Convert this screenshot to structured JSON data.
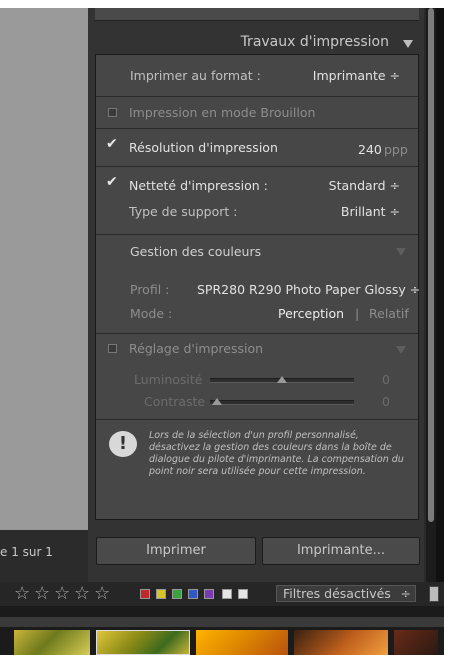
{
  "panel": {
    "title": "Travaux d'impression",
    "print_format_label": "Imprimer au format :",
    "print_format_value": "Imprimante ÷",
    "draft_mode_label": "Impression en mode Brouillon",
    "resolution_label": "Résolution d'impression",
    "resolution_value": "240",
    "resolution_unit": "ppp",
    "sharpen_label": "Netteté d'impression :",
    "sharpen_value": "Standard ÷",
    "media_label": "Type de support :",
    "media_value": "Brillant ÷",
    "color_mgmt_title": "Gestion des couleurs",
    "profile_label": "Profil :",
    "profile_value": "SPR280 R290 Photo Paper Glossy ÷",
    "mode_label": "Mode :",
    "mode_perception": "Perception",
    "mode_separator": "|",
    "mode_relative": "Relatif",
    "print_adjust_label": "Réglage d'impression",
    "brightness_label": "Luminosité",
    "brightness_value": "0",
    "contrast_label": "Contraste",
    "contrast_value": "0",
    "info_text": "Lors de la sélection d'un profil personnalisé, désactivez la gestion des couleurs dans la boîte de dialogue du pilote d'imprimante. La compensation du point noir sera utilisée pour cette impression."
  },
  "controls": {
    "draft_checked": false,
    "resolution_checked": true,
    "sharpen_checked": true,
    "print_adjust_checked": false,
    "brightness_level": 0.5,
    "contrast_level": 0.05
  },
  "buttons": {
    "print": "Imprimer",
    "printer": "Imprimante..."
  },
  "page_indicator": "e 1 sur 1",
  "filter": {
    "value": "Filtres désactivés",
    "arrow": "÷"
  },
  "colors": {
    "swatches": [
      "#c0282a",
      "#d6c52a",
      "#3ba33b",
      "#3257c4",
      "#7a3bb0",
      "#e6e6e6",
      "#e6e6e6"
    ]
  },
  "icons": {
    "collapse": "triangle-down-icon",
    "info": "exclamation-icon",
    "star": "star-icon"
  }
}
